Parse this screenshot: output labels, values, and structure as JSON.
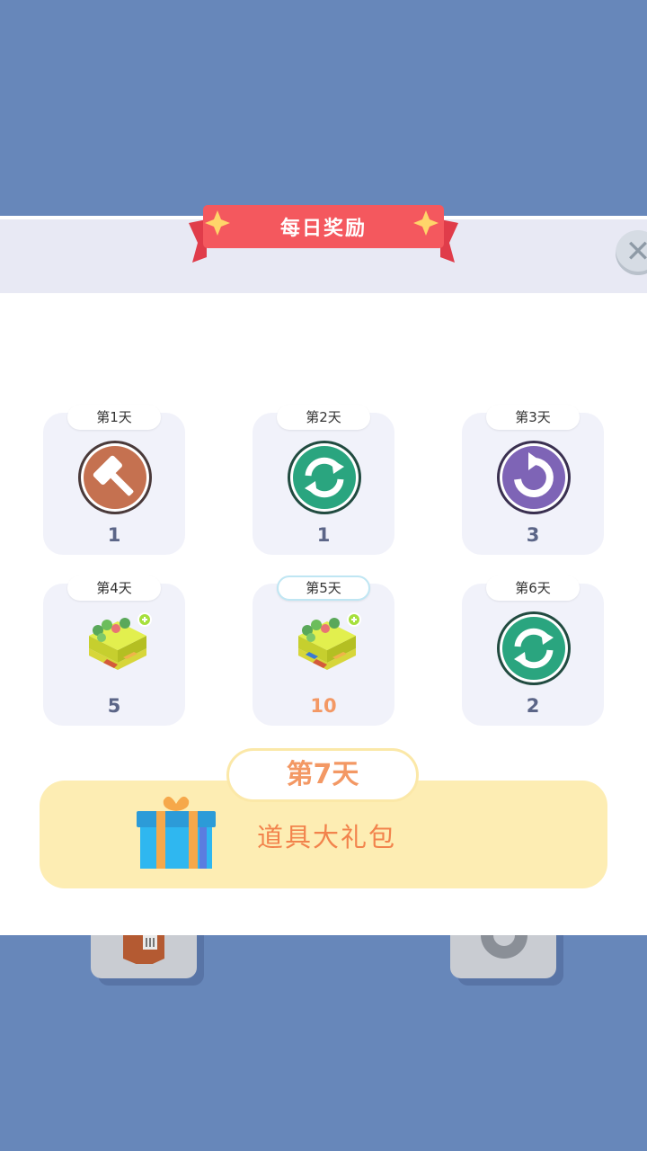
{
  "dialog": {
    "title": "每日奖励",
    "close_glyph": "✕"
  },
  "days": [
    {
      "label": "第1天",
      "icon": "hammer-icon",
      "count": "1"
    },
    {
      "label": "第2天",
      "icon": "refresh-icon",
      "count": "1"
    },
    {
      "label": "第3天",
      "icon": "rotate-icon",
      "count": "3"
    },
    {
      "label": "第4天",
      "icon": "island-tile-icon",
      "count": "5"
    },
    {
      "label": "第5天",
      "icon": "island-tile-icon",
      "count": "10",
      "today": true
    },
    {
      "label": "第6天",
      "icon": "refresh-icon",
      "count": "2"
    }
  ],
  "bonus": {
    "label": "第7天",
    "reward": "道具大礼包",
    "icon": "gift-box-icon"
  },
  "colors": {
    "background": "#6787ba",
    "header": "#e8e9f4",
    "card": "#f1f2fa",
    "banner": "#f25a5f",
    "highlight_text": "#f39864",
    "bonus_bg": "#fdedb3",
    "hammer": "#c57150",
    "refresh": "#2aa57f",
    "rotate": "#7e64b6"
  }
}
